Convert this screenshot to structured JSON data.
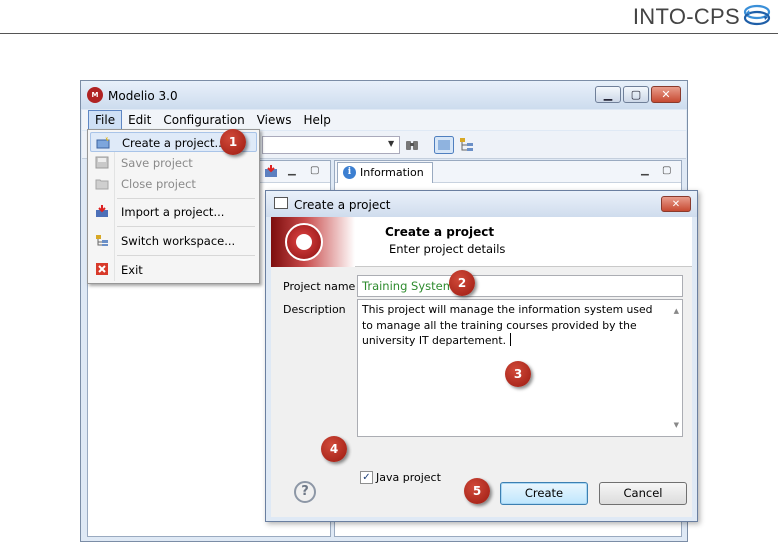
{
  "doc": {
    "brand": "INTO-CPS"
  },
  "window": {
    "title": "Modelio 3.0",
    "caption": {
      "minimize": "▁",
      "maximize": "▢",
      "close": "✕"
    },
    "menu": [
      "File",
      "Edit",
      "Configuration",
      "Views",
      "Help"
    ]
  },
  "file_menu": {
    "items": [
      {
        "label": "Create a project...",
        "enabled": true,
        "icon": "new-project-icon"
      },
      {
        "label": "Save project",
        "enabled": false,
        "icon": "save-icon"
      },
      {
        "label": "Close project",
        "enabled": false,
        "icon": "folder-icon"
      },
      {
        "label": "Import a project...",
        "enabled": true,
        "icon": "import-icon"
      },
      {
        "label": "Switch workspace...",
        "enabled": true,
        "icon": "workspace-icon"
      },
      {
        "label": "Exit",
        "enabled": true,
        "icon": "exit-icon"
      }
    ]
  },
  "right_pane": {
    "tab": "Information"
  },
  "dialog": {
    "title": "Create a project",
    "banner_title": "Create a project",
    "banner_subtitle": "Enter project details",
    "project_name_label": "Project name",
    "project_name_value": "Training System",
    "description_label": "Description",
    "description_value": "This project will manage the information system used to manage all the training courses provided by the university IT departement.",
    "java_project_label": "Java project",
    "java_project_checked": true,
    "help": "?",
    "create_label": "Create",
    "cancel_label": "Cancel"
  },
  "markers": [
    "1",
    "2",
    "3",
    "4",
    "5"
  ],
  "colors": {
    "marker": "#b0271b",
    "project_name_text": "#2e8b2e",
    "window_frame": "#dfe9f5"
  }
}
